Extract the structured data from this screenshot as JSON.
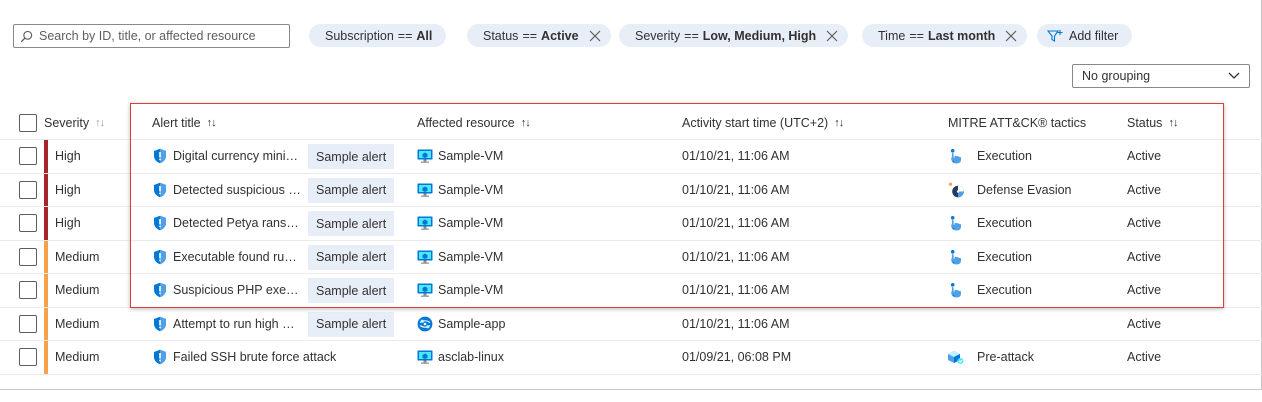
{
  "toolbar": {
    "search_placeholder": "Search by ID, title, or affected resource",
    "filters": [
      {
        "key": "Subscription",
        "op": "==",
        "value": "All",
        "removable": false
      },
      {
        "key": "Status",
        "op": "==",
        "value": "Active",
        "removable": true
      },
      {
        "key": "Severity",
        "op": "==",
        "value": "Low, Medium, High",
        "removable": true
      },
      {
        "key": "Time",
        "op": "==",
        "value": "Last month",
        "removable": true
      }
    ],
    "add_filter_label": "Add filter",
    "grouping_value": "No grouping"
  },
  "table": {
    "columns": {
      "severity": "Severity",
      "title": "Alert title",
      "resource": "Affected resource",
      "time": "Activity start time (UTC+2)",
      "mitre": "MITRE ATT&CK® tactics",
      "status": "Status"
    },
    "sample_label": "Sample alert",
    "rows": [
      {
        "severity": "High",
        "title": "Digital currency mining related behavior detected",
        "sample": true,
        "resource": "Sample-VM",
        "resource_icon": "vm-icon",
        "time": "01/10/21, 11:06 AM",
        "mitre": "Execution",
        "mitre_icon": "execution-icon",
        "status": "Active"
      },
      {
        "severity": "High",
        "title": "Detected suspicious file creation",
        "sample": true,
        "resource": "Sample-VM",
        "resource_icon": "vm-icon",
        "time": "01/10/21, 11:06 AM",
        "mitre": "Defense Evasion",
        "mitre_icon": "defense-evasion-icon",
        "status": "Active"
      },
      {
        "severity": "High",
        "title": "Detected Petya ransomware indicators",
        "sample": true,
        "resource": "Sample-VM",
        "resource_icon": "vm-icon",
        "time": "01/10/21, 11:06 AM",
        "mitre": "Execution",
        "mitre_icon": "execution-icon",
        "status": "Active"
      },
      {
        "severity": "Medium",
        "title": "Executable found running from a suspicious location",
        "sample": true,
        "resource": "Sample-VM",
        "resource_icon": "vm-icon",
        "time": "01/10/21, 11:06 AM",
        "mitre": "Execution",
        "mitre_icon": "execution-icon",
        "status": "Active"
      },
      {
        "severity": "Medium",
        "title": "Suspicious PHP execution detected",
        "sample": true,
        "resource": "Sample-VM",
        "resource_icon": "vm-icon",
        "time": "01/10/21, 11:06 AM",
        "mitre": "Execution",
        "mitre_icon": "execution-icon",
        "status": "Active"
      },
      {
        "severity": "Medium",
        "title": "Attempt to run high privilege command detected",
        "sample": true,
        "resource": "Sample-app",
        "resource_icon": "app-service-icon",
        "time": "01/10/21, 11:06 AM",
        "mitre": "",
        "mitre_icon": "",
        "status": "Active"
      },
      {
        "severity": "Medium",
        "title": "Failed SSH brute force attack",
        "sample": false,
        "resource": "asclab-linux",
        "resource_icon": "vm-icon",
        "time": "01/09/21, 06:08 PM",
        "mitre": "Pre-attack",
        "mitre_icon": "pre-attack-icon",
        "status": "Active"
      }
    ]
  },
  "colors": {
    "high": "#a4262c",
    "medium": "#f7a14a",
    "pill_bg": "#e8eef8",
    "accent": "#0078d4",
    "highlight": "#e03c3c"
  }
}
